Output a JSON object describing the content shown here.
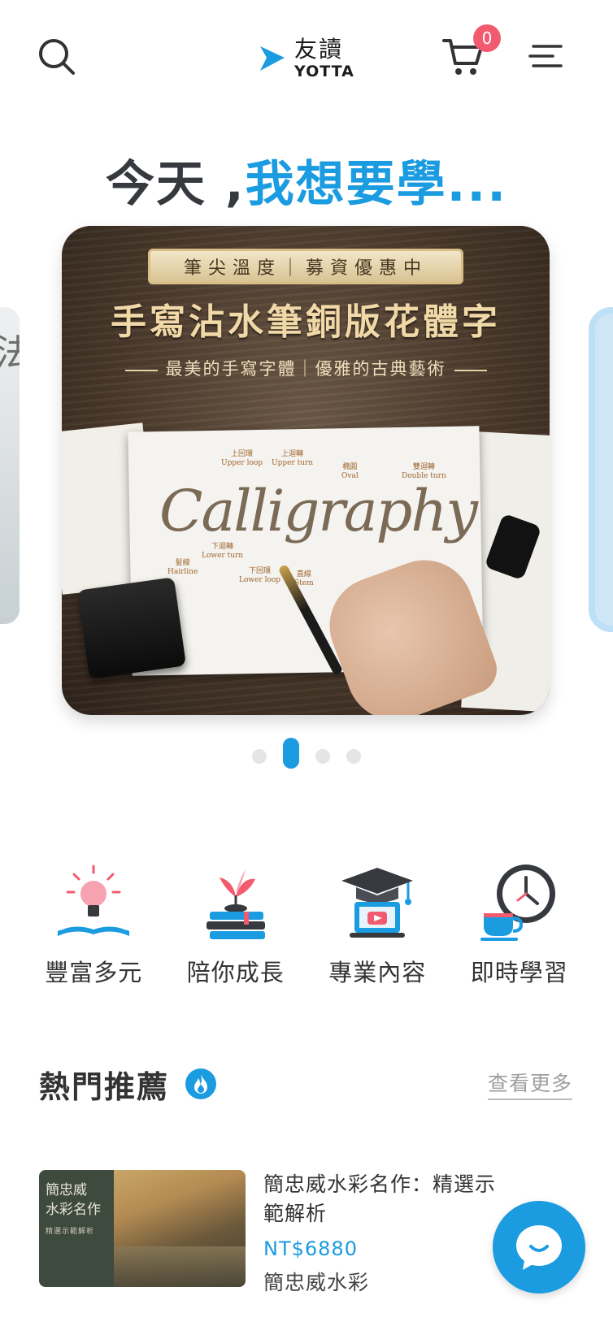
{
  "header": {
    "logo_cn": "友讀",
    "logo_en": "YOTTA",
    "cart_count": "0",
    "icons": [
      "search-icon",
      "cart-icon",
      "menu-icon"
    ]
  },
  "hero": {
    "title_dark": "今天 ,",
    "title_blue": "我想要學..."
  },
  "carousel": {
    "active_index": 1,
    "total": 4,
    "slide": {
      "tag": "筆尖溫度｜募資優惠中",
      "title": "手寫沾水筆銅版花體字",
      "subtitle": "最美的手寫字體｜優雅的古典藝術",
      "word": "Calligraphy",
      "annotations": [
        {
          "cn": "上回環",
          "en": "Upper loop"
        },
        {
          "cn": "上迴轉",
          "en": "Upper turn"
        },
        {
          "cn": "橢圓",
          "en": "Oval"
        },
        {
          "cn": "雙迴轉",
          "en": "Double turn"
        },
        {
          "cn": "髮線",
          "en": "Hairline"
        },
        {
          "cn": "下迴轉",
          "en": "Lower turn"
        },
        {
          "cn": "下回環",
          "en": "Lower loop"
        },
        {
          "cn": "直線",
          "en": "Stem"
        }
      ]
    },
    "prev_char": "法"
  },
  "features": [
    {
      "label": "豐富多元",
      "icon": "lightbulb-book-icon"
    },
    {
      "label": "陪你成長",
      "icon": "plant-books-icon"
    },
    {
      "label": "專業內容",
      "icon": "graduation-video-icon"
    },
    {
      "label": "即時學習",
      "icon": "clock-cup-icon"
    }
  ],
  "section": {
    "title": "熱門推薦",
    "more": "查看更多"
  },
  "course": {
    "thumb_title": "簡忠威\n水彩名作",
    "thumb_sub": "精選示範解析",
    "title": "簡忠威水彩名作：精選示範解析",
    "price": "NT$6880",
    "author": "簡忠威水彩"
  },
  "colors": {
    "accent": "#1b9be0",
    "badge": "#f25b6f",
    "text": "#333333"
  }
}
